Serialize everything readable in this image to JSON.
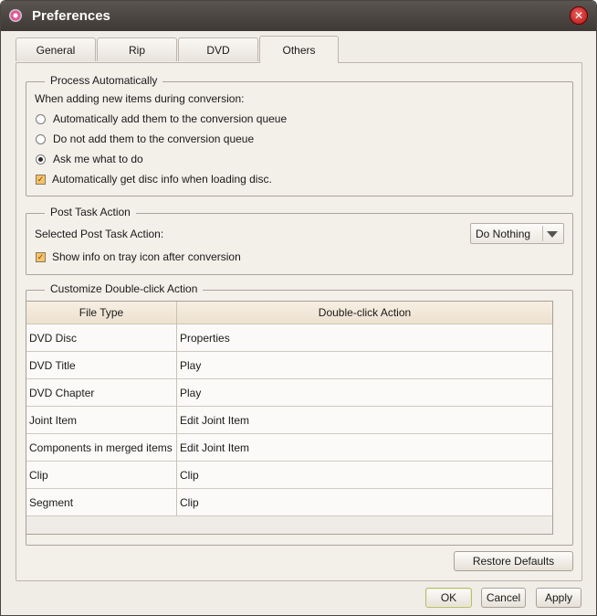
{
  "window": {
    "title": "Preferences"
  },
  "tabs": [
    "General",
    "Rip",
    "DVD",
    "Others"
  ],
  "active_tab": "Others",
  "process": {
    "legend": "Process Automatically",
    "prompt": "When adding new items during conversion:",
    "options": [
      "Automatically add them to the conversion queue",
      "Do not add them to the conversion queue",
      "Ask me what to do"
    ],
    "selected_option": "Ask me what to do",
    "disc_info_label": "Automatically get disc info when loading disc.",
    "disc_info_checked": true
  },
  "post_task": {
    "legend": "Post Task Action",
    "label": "Selected Post Task Action:",
    "selected": "Do Nothing",
    "tray_info_label": "Show info on tray icon after conversion",
    "tray_info_checked": true
  },
  "double_click": {
    "legend": "Customize Double-click Action",
    "columns": [
      "File Type",
      "Double-click Action"
    ],
    "rows": [
      [
        "DVD Disc",
        "Properties"
      ],
      [
        "DVD Title",
        "Play"
      ],
      [
        "DVD Chapter",
        "Play"
      ],
      [
        "Joint Item",
        "Edit Joint Item"
      ],
      [
        "Components in merged items",
        "Edit Joint Item"
      ],
      [
        "Clip",
        "Clip"
      ],
      [
        "Segment",
        "Clip"
      ]
    ]
  },
  "buttons": {
    "restore": "Restore Defaults",
    "ok": "OK",
    "cancel": "Cancel",
    "apply": "Apply"
  },
  "icons": {
    "app": "disc-icon",
    "close": "close-icon",
    "combo_arrow": "chevron-down-icon",
    "check": "checkmark-icon",
    "close_glyph": "✕"
  }
}
